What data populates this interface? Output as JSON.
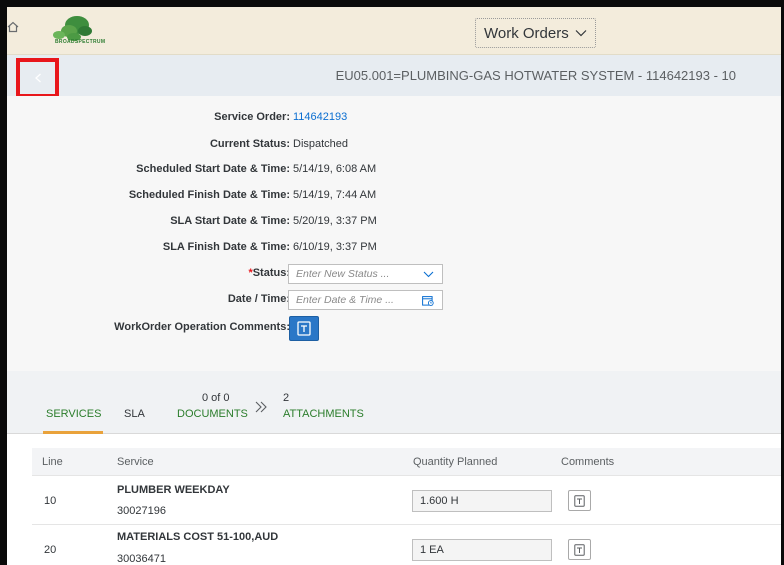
{
  "shell": {
    "home_icon": "home-icon",
    "logo_text": "BROADSPECTRUM",
    "app_menu_label": "Work Orders",
    "app_menu_icon": "chevron-down-icon"
  },
  "subheader": {
    "back_icon": "chevron-left-icon",
    "title": "EU05.001=PLUMBING-GAS HOTWATER SYSTEM - 114642193 - 10"
  },
  "form": {
    "service_order": {
      "label": "Service Order:",
      "value": "114642193"
    },
    "current_status": {
      "label": "Current Status:",
      "value": "Dispatched"
    },
    "scheduled_start": {
      "label": "Scheduled Start Date & Time:",
      "value": "5/14/19, 6:08 AM"
    },
    "scheduled_finish": {
      "label": "Scheduled Finish Date & Time:",
      "value": "5/14/19, 7:44 AM"
    },
    "sla_start": {
      "label": "SLA Start Date & Time:",
      "value": "5/20/19, 3:37 PM"
    },
    "sla_finish": {
      "label": "SLA Finish Date & Time:",
      "value": "6/10/19, 3:37 PM"
    },
    "status": {
      "required_mark": "*",
      "label": "Status:",
      "placeholder": "Enter New Status ..."
    },
    "date_time": {
      "label": "Date / Time:",
      "placeholder": "Enter Date & Time ..."
    },
    "comments": {
      "label": "WorkOrder Operation Comments:"
    }
  },
  "tabs": {
    "services": "SERVICES",
    "sla": "SLA",
    "documents_count": "0 of 0",
    "documents": "DOCUMENTS",
    "attachments_count": "2",
    "attachments": "ATTACHMENTS",
    "overflow_icon": "double-chevron-right-icon",
    "active": "SERVICES",
    "accent_color": "#e9a23b"
  },
  "table": {
    "headers": [
      "Line",
      "Service",
      "Quantity Planned",
      "Comments"
    ],
    "rows": [
      {
        "line": "10",
        "service": "PLUMBER WEEKDAY",
        "code": "30027196",
        "quantity": "1.600 H"
      },
      {
        "line": "20",
        "service": "MATERIALS COST 51-100,AUD",
        "code": "30036471",
        "quantity": "1 EA"
      }
    ]
  }
}
